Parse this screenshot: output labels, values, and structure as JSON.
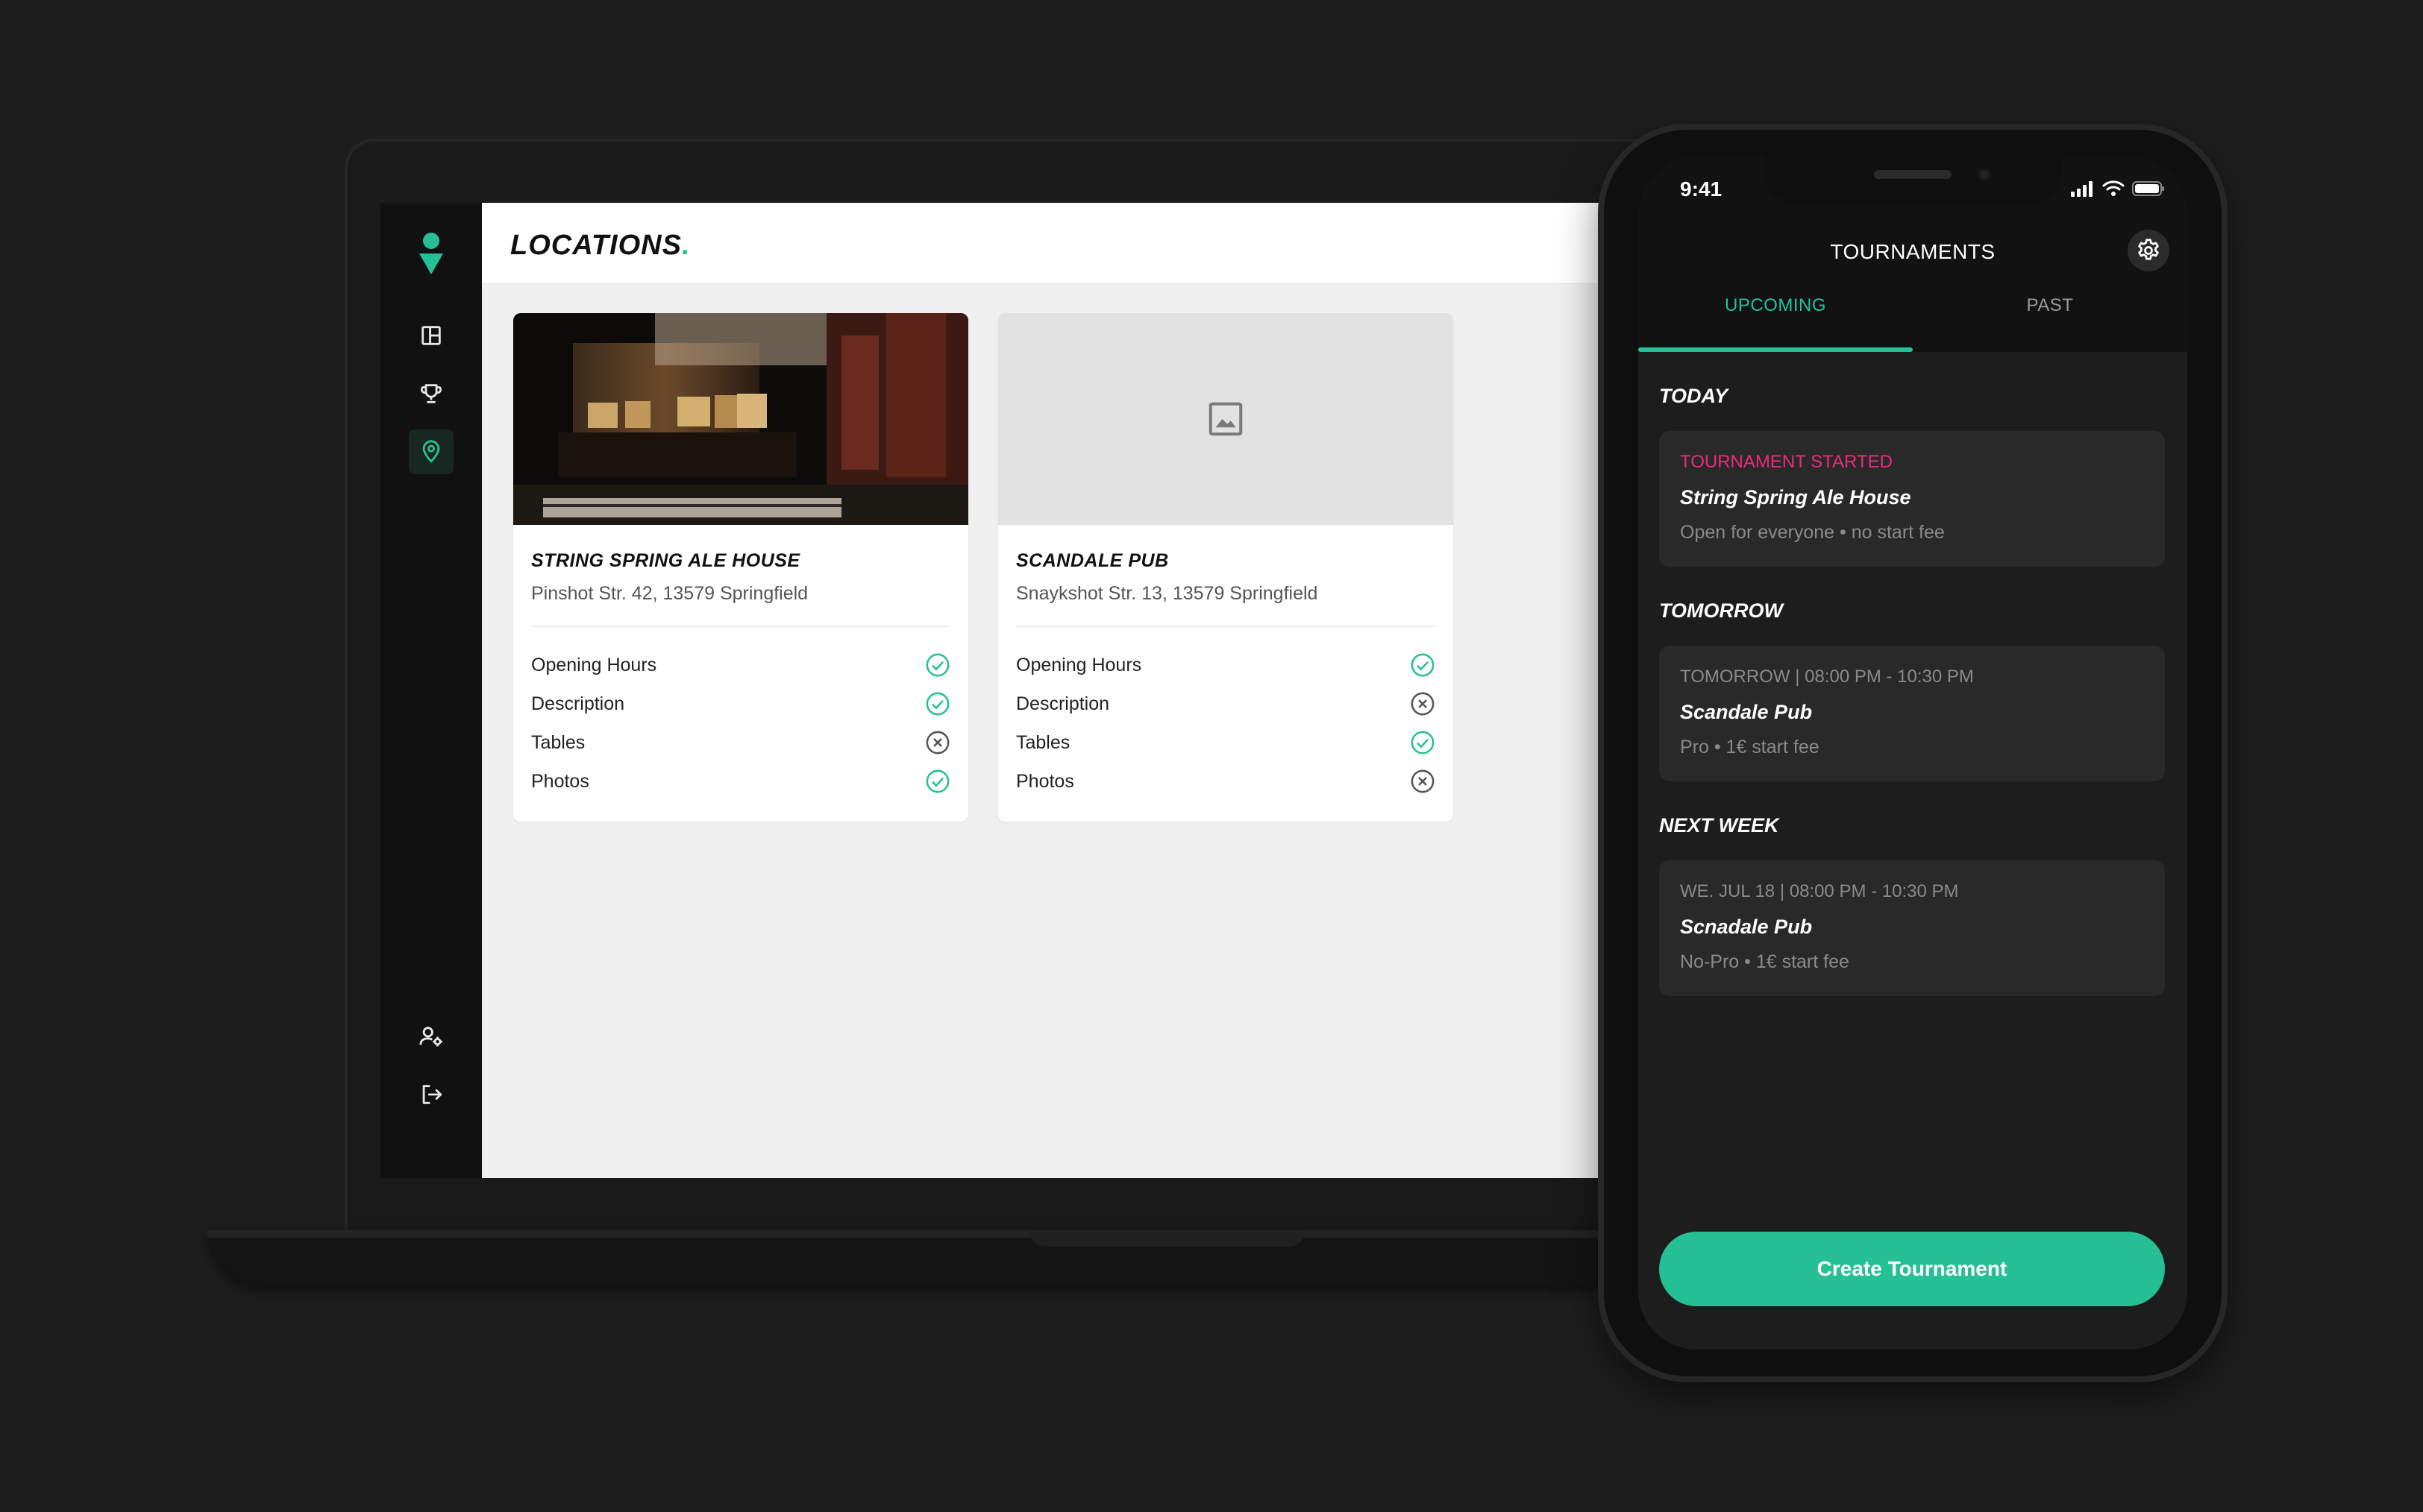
{
  "colors": {
    "accent": "#26c096",
    "alert": "#ee2a7b"
  },
  "laptop": {
    "sidebar": {
      "items": [
        {
          "icon": "dashboard-icon"
        },
        {
          "icon": "trophy-icon"
        },
        {
          "icon": "location-pin-icon",
          "active": true
        },
        {
          "icon": "user-settings-icon"
        },
        {
          "icon": "logout-icon"
        }
      ]
    },
    "header": {
      "title": "LOCATIONS",
      "title_dot": "."
    },
    "cards": [
      {
        "name": "STRING SPRING ALE HOUSE",
        "address": "Pinshot Str. 42, 13579 Springfield",
        "checks": [
          {
            "label": "Opening Hours",
            "status": "ok"
          },
          {
            "label": "Description",
            "status": "ok"
          },
          {
            "label": "Tables",
            "status": "missing"
          },
          {
            "label": "Photos",
            "status": "ok"
          }
        ]
      },
      {
        "name": "SCANDALE PUB",
        "address": "Snaykshot Str. 13, 13579 Springfield",
        "checks": [
          {
            "label": "Opening Hours",
            "status": "ok"
          },
          {
            "label": "Description",
            "status": "missing"
          },
          {
            "label": "Tables",
            "status": "ok"
          },
          {
            "label": "Photos",
            "status": "missing"
          }
        ]
      }
    ]
  },
  "phone": {
    "status_time": "9:41",
    "title": "TOURNAMENTS",
    "tabs": {
      "upcoming": "UPCOMING",
      "past": "PAST"
    },
    "sections": [
      {
        "label": "TODAY",
        "event": {
          "line1": "TOURNAMENT STARTED",
          "name": "String Spring Ale House",
          "line3": "Open for everyone • no start fee"
        }
      },
      {
        "label": "TOMORROW",
        "event": {
          "line1": "TOMORROW | 08:00 PM - 10:30 PM",
          "name": "Scandale Pub",
          "line3": "Pro • 1€ start fee"
        }
      },
      {
        "label": "NEXT WEEK",
        "event": {
          "line1": "WE. JUL 18 | 08:00 PM - 10:30 PM",
          "name": "Scnadale Pub",
          "line3": "No-Pro • 1€ start fee"
        }
      }
    ],
    "create_button": "Create Tournament"
  }
}
